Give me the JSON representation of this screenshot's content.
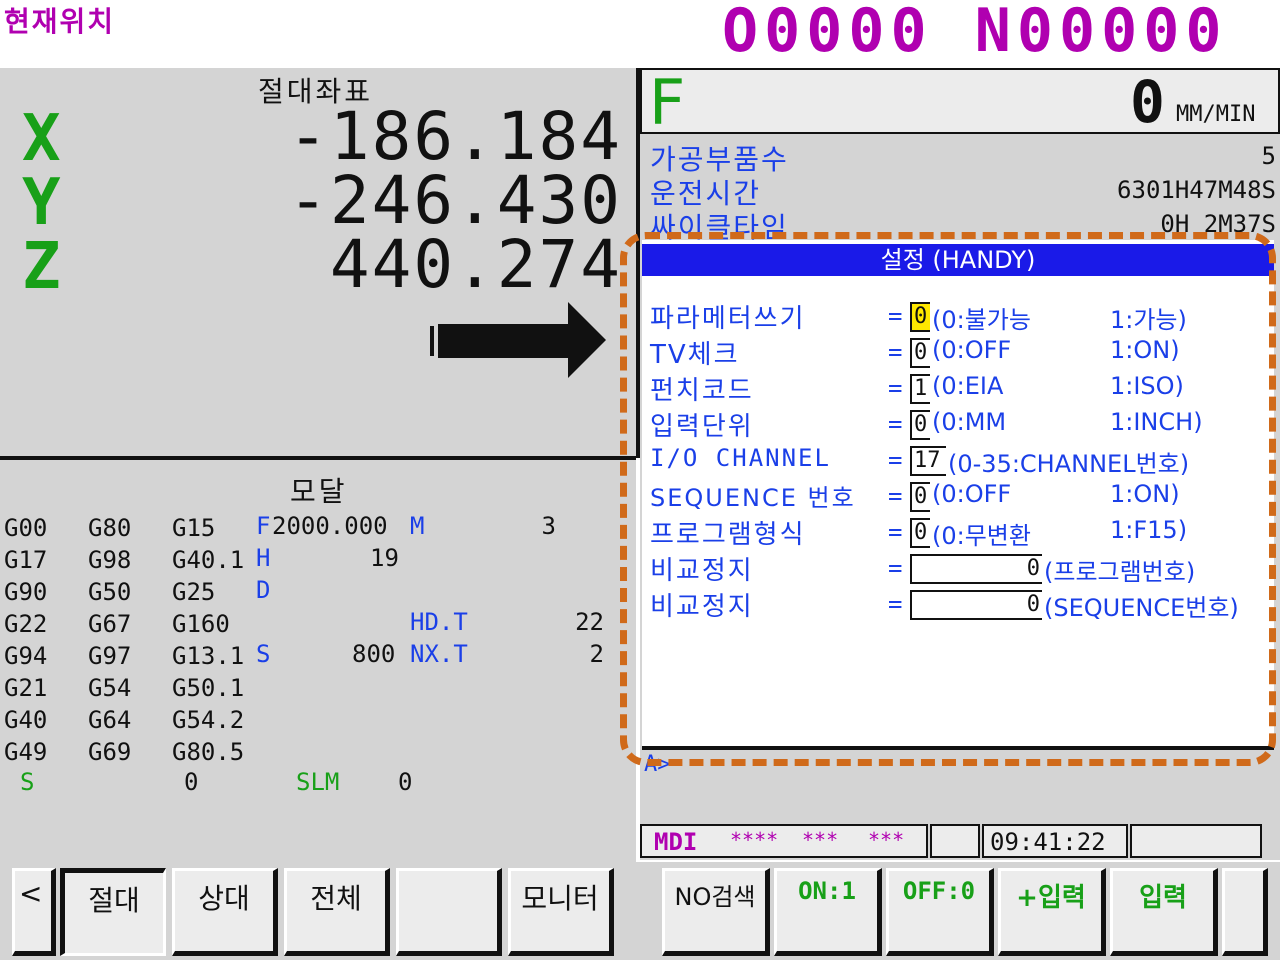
{
  "header": {
    "title": "현재위치",
    "o_number": "O0000",
    "n_number": "N00000"
  },
  "position": {
    "heading": "절대좌표",
    "axes": [
      {
        "axis": "X",
        "value": "-186.184"
      },
      {
        "axis": "Y",
        "value": "-246.430"
      },
      {
        "axis": "Z",
        "value": "440.274"
      }
    ]
  },
  "modal": {
    "heading": "모달",
    "rows": [
      [
        "G00",
        "G80",
        "G15"
      ],
      [
        "G17",
        "G98",
        "G40.1"
      ],
      [
        "G90",
        "G50",
        "G25"
      ],
      [
        "G22",
        "G67",
        "G160"
      ],
      [
        "G94",
        "G97",
        "G13.1"
      ],
      [
        "G21",
        "G54",
        "G50.1"
      ],
      [
        "G40",
        "G64",
        "G54.2"
      ],
      [
        "G49",
        "G69",
        "G80.5"
      ]
    ],
    "f_label": "F",
    "f_value": "2000.000",
    "m_label": "M",
    "m_value": "3",
    "h_label": "H",
    "h_value": "19",
    "d_label": "D",
    "hdt_label": "HD.T",
    "hdt_value": "22",
    "s_label": "S",
    "s_value": "800",
    "nxt_label": "NX.T",
    "nxt_value": "2",
    "s2_label": "S",
    "s2_value": "0",
    "slm_label": "SLM",
    "slm_value": "0"
  },
  "feed": {
    "label": "F",
    "value": "0",
    "unit": "MM/MIN"
  },
  "info": {
    "parts_label": "가공부품수",
    "parts_value": "5",
    "runtime_label": "운전시간",
    "runtime_value": "6301H47M48S",
    "cycle_label": "싸이클타임",
    "cycle_value": "0H 2M37S"
  },
  "settings": {
    "title": "설정 (HANDY)",
    "rows": [
      {
        "label": "파라메터쓰기",
        "value": "0",
        "option0": "(0:불가능",
        "option1": "1:가능)"
      },
      {
        "label": "TV체크",
        "value": "0",
        "option0": "(0:OFF",
        "option1": "1:ON)"
      },
      {
        "label": "펀치코드",
        "value": "1",
        "option0": "(0:EIA",
        "option1": "1:ISO)"
      },
      {
        "label": "입력단위",
        "value": "0",
        "option0": "(0:MM",
        "option1": "1:INCH)"
      },
      {
        "label": "I/O CHANNEL",
        "value": "17",
        "option0": "(0-35:CHANNEL번호)",
        "option1": ""
      },
      {
        "label": "SEQUENCE 번호",
        "value": "0",
        "option0": "(0:OFF",
        "option1": "1:ON)"
      },
      {
        "label": "프로그램형식",
        "value": "0",
        "option0": "(0:무변환",
        "option1": "1:F15)"
      },
      {
        "label": "비교정지",
        "value": "0",
        "option0": "(프로그램번호)",
        "option1": ""
      },
      {
        "label": "비교정지",
        "value": "0",
        "option0": "(SEQUENCE번호)",
        "option1": ""
      }
    ],
    "prompt": "A>"
  },
  "status": {
    "mode": "MDI",
    "s1": "****",
    "s2": "***",
    "s3": "***",
    "time": "09:41:22"
  },
  "softkeys_left": [
    {
      "label": "<"
    },
    {
      "label": "절대"
    },
    {
      "label": "상대"
    },
    {
      "label": "전체"
    },
    {
      "label": ""
    },
    {
      "label": "모니터"
    }
  ],
  "softkeys_right": [
    {
      "label": "NO검색"
    },
    {
      "label": "ON:1"
    },
    {
      "label": "OFF:0"
    },
    {
      "label": "+입력"
    },
    {
      "label": "입력"
    },
    {
      "label": ""
    }
  ],
  "colors": {
    "magenta": "#b000b0",
    "green": "#18a018",
    "blue": "#1a3fe8",
    "highlight": "#ffe800",
    "annotation": "#d06a1a"
  }
}
